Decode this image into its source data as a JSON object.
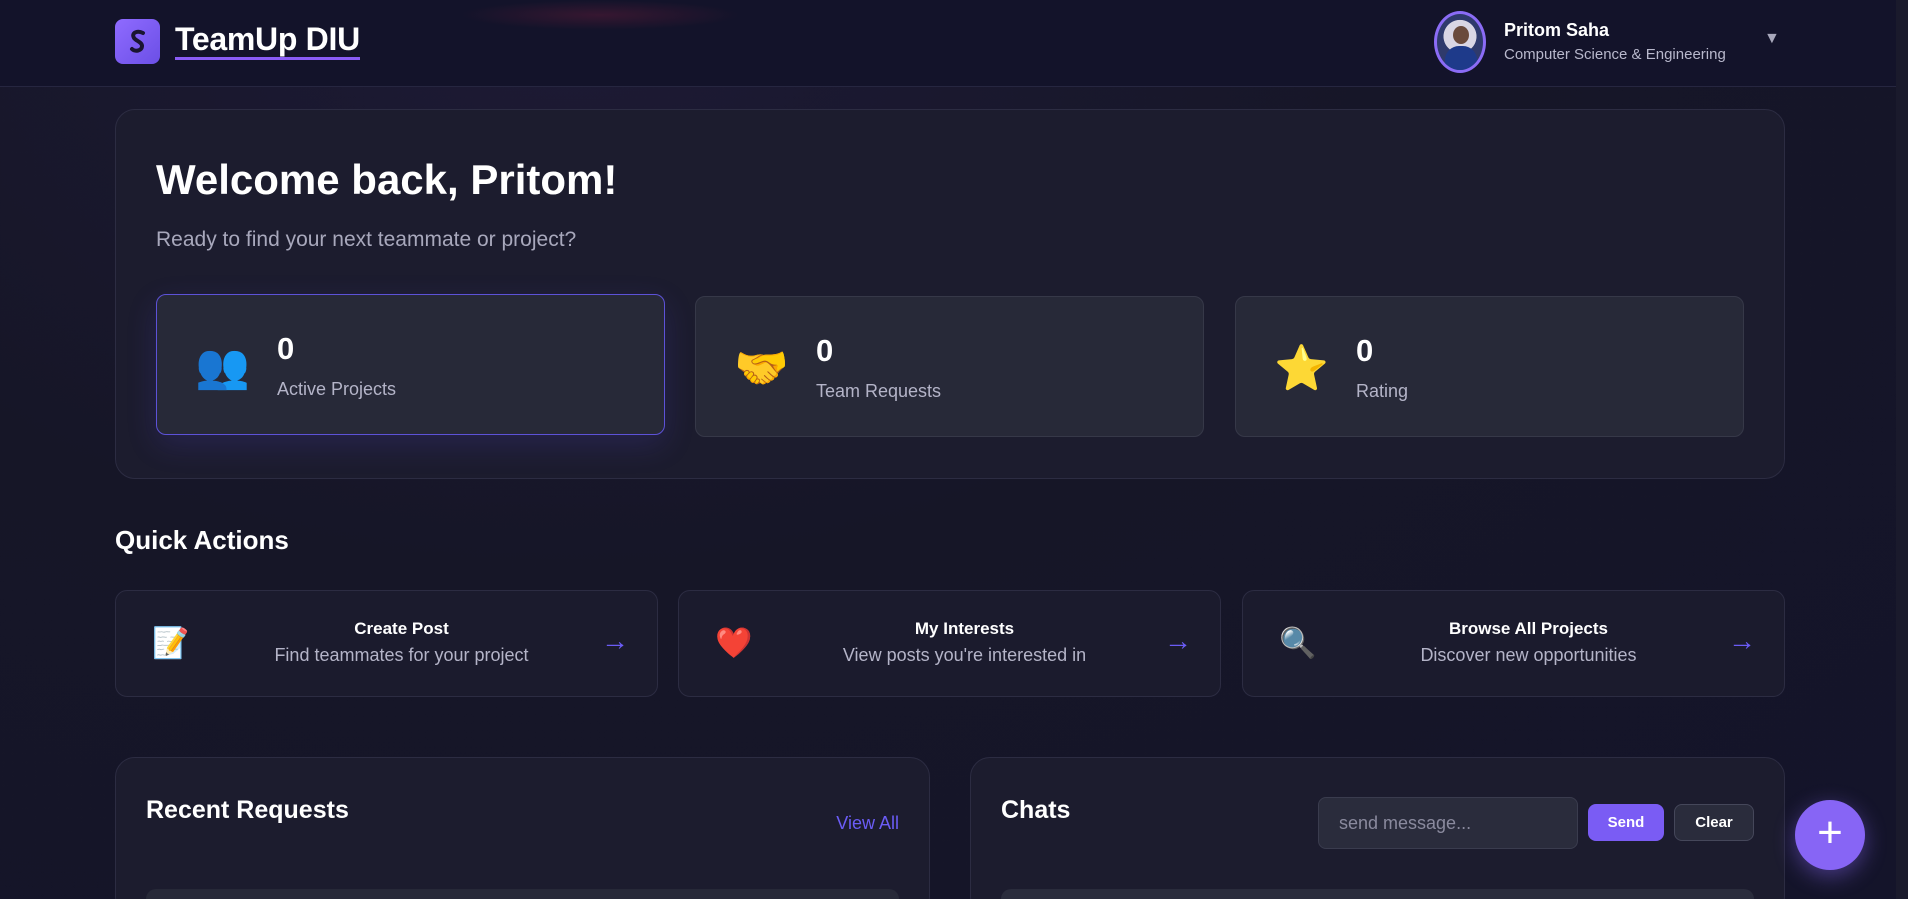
{
  "app": {
    "logo_icon": "brand-s-icon",
    "name": "TeamUp DIU",
    "accent_color": "#7a5cf4"
  },
  "user": {
    "name": "Pritom Saha",
    "department": "Computer Science & Engineering",
    "dropdown_icon": "▼"
  },
  "welcome": {
    "title": "Welcome back, Pritom!",
    "subtitle": "Ready to find your next teammate or project?"
  },
  "stats": [
    {
      "icon": "👥",
      "icon_name": "people-icon",
      "value": "0",
      "label": "Active Projects"
    },
    {
      "icon": "🤝",
      "icon_name": "handshake-icon",
      "value": "0",
      "label": "Team Requests"
    },
    {
      "icon": "⭐",
      "icon_name": "star-icon",
      "value": "0",
      "label": "Rating"
    }
  ],
  "quick_actions": {
    "title": "Quick Actions",
    "items": [
      {
        "icon": "📝",
        "icon_name": "memo-icon",
        "title": "Create Post",
        "subtitle": "Find teammates for your project",
        "arrow": "→"
      },
      {
        "icon": "❤️",
        "icon_name": "heart-icon",
        "title": "My Interests",
        "subtitle": "View posts you're interested in",
        "arrow": "→"
      },
      {
        "icon": "🔍",
        "icon_name": "magnifier-icon",
        "title": "Browse All Projects",
        "subtitle": "Discover new opportunities",
        "arrow": "→"
      }
    ]
  },
  "recent_requests": {
    "title": "Recent Requests",
    "view_all": "View All"
  },
  "chats": {
    "title": "Chats",
    "input_placeholder": "send message...",
    "send_label": "Send",
    "clear_label": "Clear"
  },
  "fab": {
    "label": "+"
  }
}
